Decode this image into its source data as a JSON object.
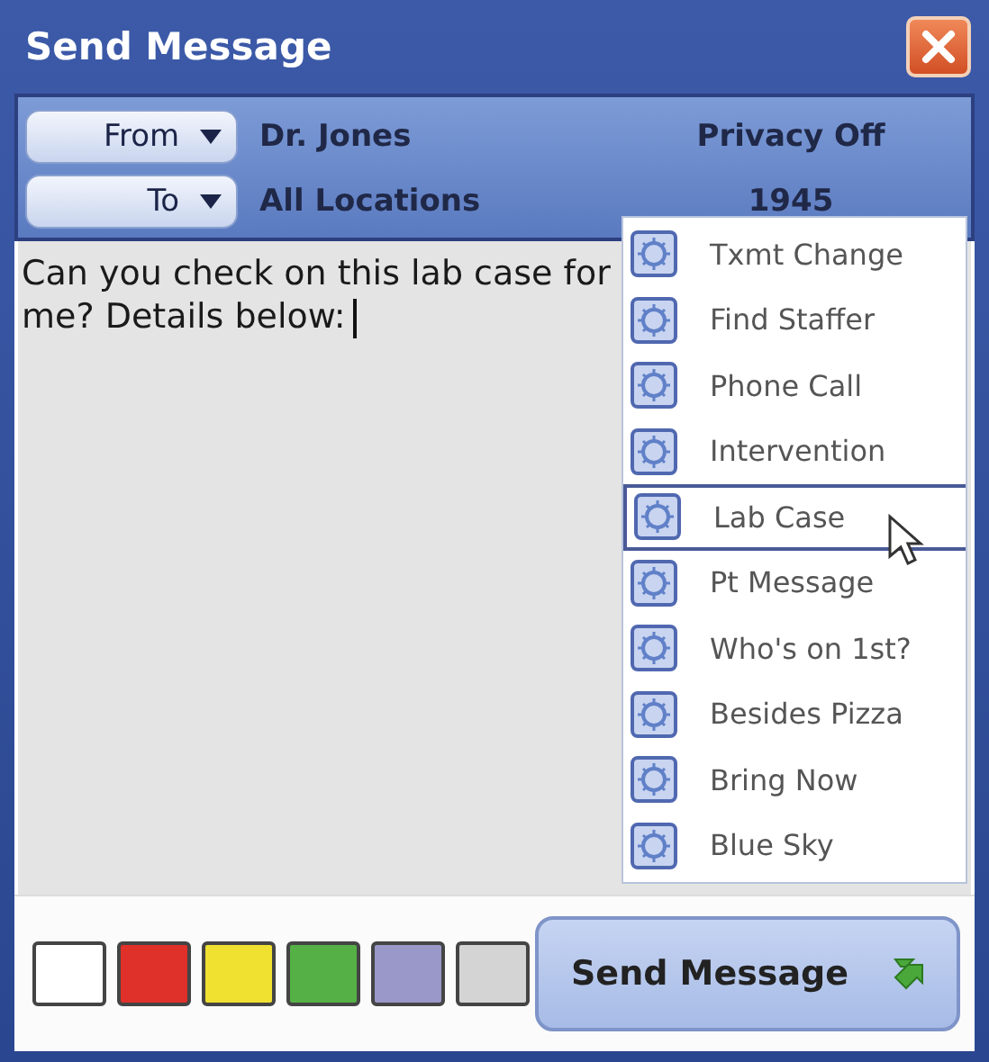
{
  "window": {
    "title": "Send Message"
  },
  "header": {
    "from": {
      "button": "From",
      "value": "Dr. Jones"
    },
    "privacy": "Privacy Off",
    "to": {
      "button": "To",
      "value": "All Locations"
    },
    "number": "1945"
  },
  "message": {
    "text": "Can you check on this lab case for me? Details below:"
  },
  "quick_menu": [
    {
      "label": "Txmt Change",
      "selected": false
    },
    {
      "label": "Find Staffer",
      "selected": false
    },
    {
      "label": "Phone Call",
      "selected": false
    },
    {
      "label": "Intervention",
      "selected": false
    },
    {
      "label": "Lab Case",
      "selected": true
    },
    {
      "label": "Pt Message",
      "selected": false
    },
    {
      "label": "Who's on 1st?",
      "selected": false
    },
    {
      "label": "Besides Pizza",
      "selected": false
    },
    {
      "label": "Bring Now",
      "selected": false
    },
    {
      "label": "Blue Sky",
      "selected": false
    }
  ],
  "colors": [
    {
      "color": "#ffffff"
    },
    {
      "color": "#e0302a"
    },
    {
      "color": "#f0e030"
    },
    {
      "color": "#55b045"
    },
    {
      "color": "#9a98c8"
    },
    {
      "color": "#d4d4d4"
    }
  ],
  "send_button": "Send Message"
}
